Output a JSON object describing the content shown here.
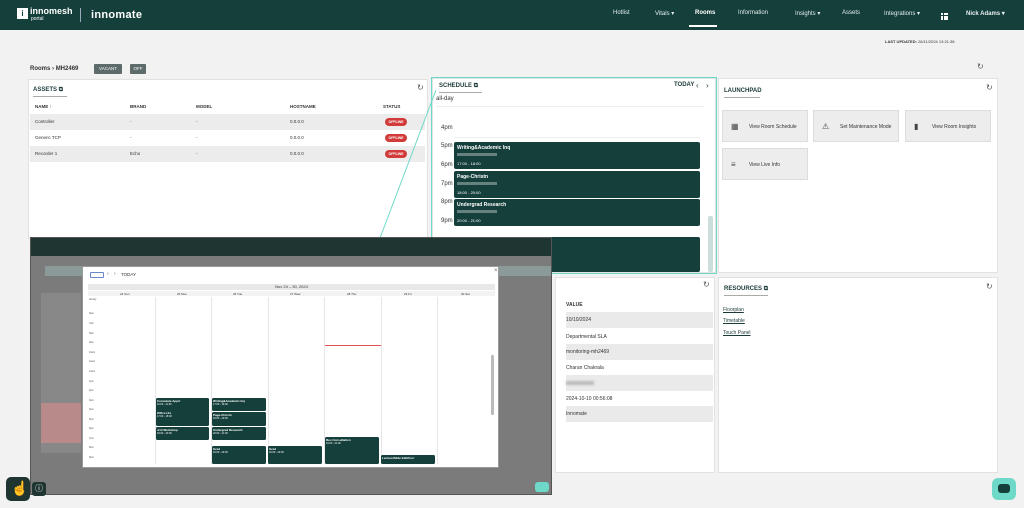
{
  "app": {
    "logo_letters": "i",
    "logo_name": "innomesh",
    "logo_sub": "portal",
    "brand": "innomate"
  },
  "nav": {
    "hotlist": "Hotlist",
    "vitals": "Vitals ▾",
    "rooms": "Rooms",
    "information": "Information",
    "insights": "Insights ▾",
    "assets": "Assets",
    "integrations": "Integrations ▾",
    "user": "Nick Adams ▾"
  },
  "last_updated": {
    "label": "LAST UPDATED:",
    "value": "26/11/2024 13:21:38"
  },
  "breadcrumb": {
    "root": "Rooms",
    "sep": "›",
    "room": "MH2469"
  },
  "tags": {
    "vacant": "VACANT",
    "off": "OFF"
  },
  "assets": {
    "title": "ASSETS",
    "headers": {
      "name": "NAME ↑",
      "brand": "BRAND",
      "model": "MODEL",
      "hostname": "HOSTNAME",
      "status": "STATUS"
    },
    "rows": [
      {
        "name": "Controller",
        "brand": "-",
        "model": "-",
        "hostname": "0.0.0.0",
        "status": "OFFLINE"
      },
      {
        "name": "Generic TCP",
        "brand": "-",
        "model": "-",
        "hostname": "0.0.0.0",
        "status": "OFFLINE"
      },
      {
        "name": "Recorder 1",
        "brand": "Echo",
        "model": "-",
        "hostname": "0.0.0.0",
        "status": "OFFLINE"
      }
    ]
  },
  "schedule": {
    "title": "SCHEDULE",
    "today": "TODAY",
    "allday": "all-day",
    "hours": [
      "4pm",
      "5pm",
      "6pm",
      "7pm",
      "8pm",
      "9pm"
    ],
    "events": [
      {
        "title": "Writing&Academic Inq",
        "time": "17:00 - 18:00"
      },
      {
        "title": "Page-Christn",
        "time": "18:00 - 20:00"
      },
      {
        "title": "Undergrad Research",
        "time": "20:00 - 21:00"
      }
    ]
  },
  "launchpad": {
    "title": "LAUNCHPAD",
    "buttons": [
      "View Room Schedule",
      "Set Maintenance Mode",
      "View Room Insights",
      "View Live Info"
    ]
  },
  "values": {
    "header": "VALUE",
    "rows": [
      "10/10/2024",
      "Departmental SLA",
      "monitoring-mh2469",
      "Charan Chakrala",
      "",
      "2024-10-10 00:56:08",
      "Innomate"
    ]
  },
  "resources": {
    "title": "RESOURCES",
    "links": [
      "Floorplan",
      "Timetable",
      "Touch Panel"
    ]
  },
  "modal": {
    "range": "Nov 24 – 30, 2024",
    "today": "TODAY",
    "close": "×",
    "allday": "all-day",
    "days": [
      "24 Sun",
      "25 Mon",
      "26 Tue",
      "27 Wed",
      "28 Thu",
      "29 Fri",
      "30 Sat"
    ],
    "times": [
      "6am",
      "7am",
      "8am",
      "9am",
      "10am",
      "11am",
      "12pm",
      "1pm",
      "2pm",
      "3pm",
      "4pm",
      "5pm",
      "6pm",
      "7pm",
      "8pm",
      "9pm"
    ],
    "events": [
      {
        "title": "Consulate Apprt",
        "time": "10:00 - 11:00"
      },
      {
        "title": "Writing&Academic Inq",
        "time": "17:00 - 18:00"
      },
      {
        "title": "Office Hrs",
        "time": "17:00 - 18:00"
      },
      {
        "title": "Page-Christn",
        "time": "18:00 - 20:00"
      },
      {
        "title": "Jrnl Workshop",
        "time": "18:00 - 20:00"
      },
      {
        "title": "Undergrad Research",
        "time": "20:00 - 21:00"
      },
      {
        "title": "Grad",
        "time": "19:00 - 20:30"
      },
      {
        "title": "Grad",
        "time": "19:00 - 20:30"
      },
      {
        "title": "Res Consultation",
        "time": "19:00 - 21:00"
      },
      {
        "title": "Lecture/Slide Edit/Curr",
        "time": "20:00 - 21:00"
      }
    ]
  }
}
